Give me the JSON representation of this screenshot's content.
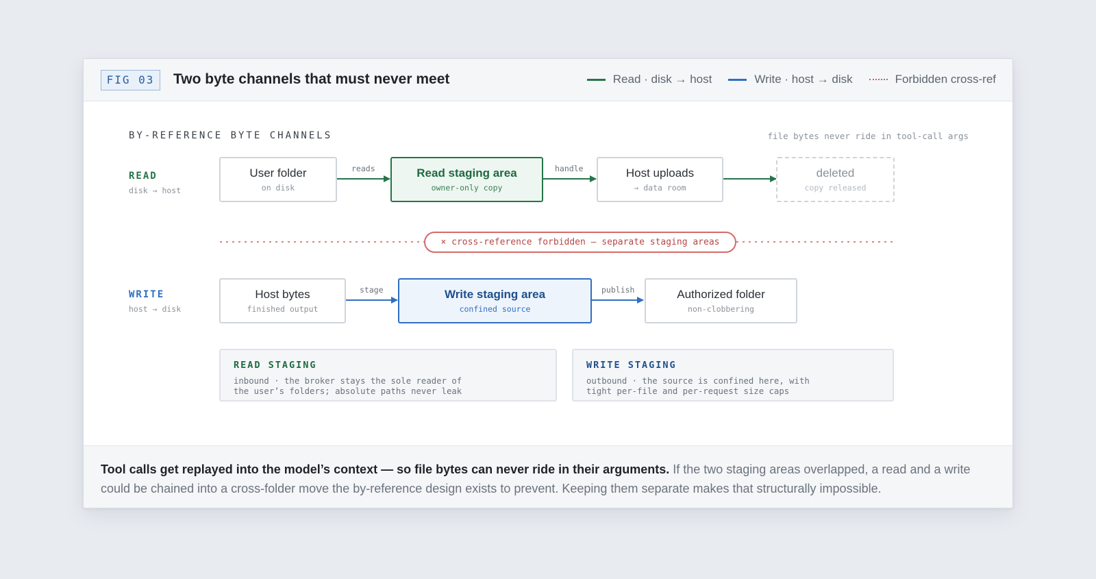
{
  "header": {
    "fig_tag": "FIG 03",
    "title": "Two byte channels that must never meet",
    "legend": [
      {
        "label": "Read · disk → host",
        "color": "#25754a",
        "style": "solid"
      },
      {
        "label": "Write · host → disk",
        "color": "#2f6fc2",
        "style": "solid"
      },
      {
        "label": "Forbidden cross-ref",
        "color": "#cf5b5b",
        "style": "dotted"
      }
    ]
  },
  "diagram": {
    "section_label": "BY-REFERENCE BYTE CHANNELS",
    "side_note": "file bytes never ride in tool-call args",
    "read": {
      "label": "READ",
      "sub": "disk → host",
      "nodes": [
        {
          "title": "User folder",
          "sub": "on disk"
        },
        {
          "title": "Read staging area",
          "sub": "owner-only copy"
        },
        {
          "title": "Host uploads",
          "sub": "→ data room"
        },
        {
          "title": "deleted",
          "sub": "copy released"
        }
      ],
      "edges": [
        "reads",
        "handle"
      ]
    },
    "forbidden": "× cross-reference forbidden — separate staging areas",
    "write": {
      "label": "WRITE",
      "sub": "host → disk",
      "nodes": [
        {
          "title": "Host bytes",
          "sub": "finished output"
        },
        {
          "title": "Write staging area",
          "sub": "confined source"
        },
        {
          "title": "Authorized folder",
          "sub": "non-clobbering"
        }
      ],
      "edges": [
        "stage",
        "publish"
      ]
    },
    "read_info": {
      "heading": "READ STAGING",
      "body": "inbound · the broker stays the sole reader of\nthe user’s folders; absolute paths never leak"
    },
    "write_info": {
      "heading": "WRITE STAGING",
      "body": "outbound · the source is confined here, with\ntight per-file and per-request size caps"
    }
  },
  "footer": {
    "lead": "Tool calls get replayed into the model’s context — so file bytes can never ride in their arguments.",
    "rest": " If the two staging areas overlapped, a read and a write could be chained into a cross-folder move the by-reference design exists to prevent. Keeping them separate makes that structurally impossible."
  },
  "colors": {
    "read": "#25754a",
    "write": "#2f6fc2",
    "forbidden": "#cf5b5b",
    "background": "#e8ebf0"
  }
}
